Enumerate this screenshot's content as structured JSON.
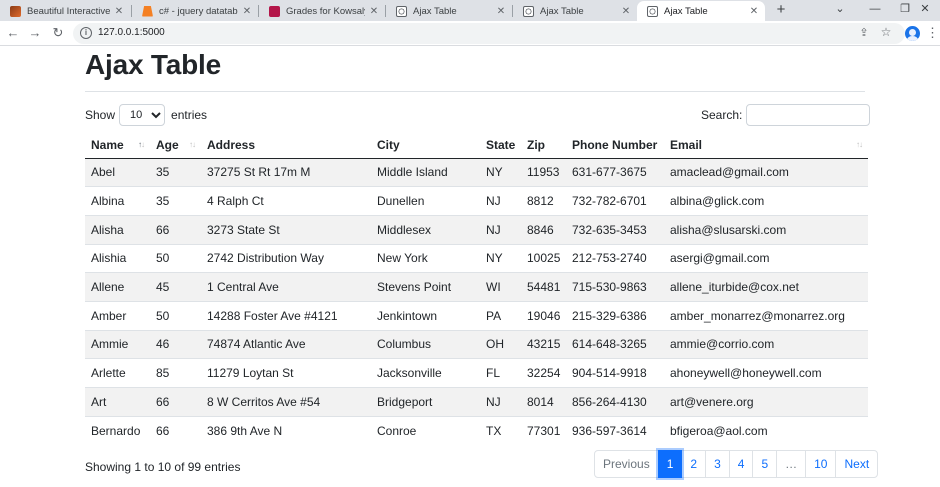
{
  "browser": {
    "tabs": [
      {
        "title": "Beautiful Interactive Ta",
        "favicon": "image-favicon"
      },
      {
        "title": "c# - jquery datatables",
        "favicon": "stackoverflow-favicon"
      },
      {
        "title": "Grades for Kowsalya V",
        "favicon": "grades-favicon"
      },
      {
        "title": "Ajax Table",
        "favicon": "globe-favicon"
      },
      {
        "title": "Ajax Table",
        "favicon": "globe-favicon"
      },
      {
        "title": "Ajax Table",
        "favicon": "globe-favicon",
        "active": true
      }
    ],
    "url": "127.0.0.1:5000"
  },
  "page": {
    "title": "Ajax Table",
    "length_prefix": "Show",
    "length_value": "10",
    "length_suffix": "entries",
    "search_label": "Search:",
    "search_value": ""
  },
  "table": {
    "columns": [
      "Name",
      "Age",
      "Address",
      "City",
      "State",
      "Zip",
      "Phone Number",
      "Email"
    ],
    "rows": [
      [
        "Abel",
        "35",
        "37275 St Rt 17m M",
        "Middle Island",
        "NY",
        "11953",
        "631-677-3675",
        "amaclead@gmail.com"
      ],
      [
        "Albina",
        "35",
        "4 Ralph Ct",
        "Dunellen",
        "NJ",
        "8812",
        "732-782-6701",
        "albina@glick.com"
      ],
      [
        "Alisha",
        "66",
        "3273 State St",
        "Middlesex",
        "NJ",
        "8846",
        "732-635-3453",
        "alisha@slusarski.com"
      ],
      [
        "Alishia",
        "50",
        "2742 Distribution Way",
        "New York",
        "NY",
        "10025",
        "212-753-2740",
        "asergi@gmail.com"
      ],
      [
        "Allene",
        "45",
        "1 Central Ave",
        "Stevens Point",
        "WI",
        "54481",
        "715-530-9863",
        "allene_iturbide@cox.net"
      ],
      [
        "Amber",
        "50",
        "14288 Foster Ave #4121",
        "Jenkintown",
        "PA",
        "19046",
        "215-329-6386",
        "amber_monarrez@monarrez.org"
      ],
      [
        "Ammie",
        "46",
        "74874 Atlantic Ave",
        "Columbus",
        "OH",
        "43215",
        "614-648-3265",
        "ammie@corrio.com"
      ],
      [
        "Arlette",
        "85",
        "11279 Loytan St",
        "Jacksonville",
        "FL",
        "32254",
        "904-514-9918",
        "ahoneywell@honeywell.com"
      ],
      [
        "Art",
        "66",
        "8 W Cerritos Ave #54",
        "Bridgeport",
        "NJ",
        "8014",
        "856-264-4130",
        "art@venere.org"
      ],
      [
        "Bernardo",
        "66",
        "386 9th Ave N",
        "Conroe",
        "TX",
        "77301",
        "936-597-3614",
        "bfigeroa@aol.com"
      ]
    ]
  },
  "footer": {
    "info": "Showing 1 to 10 of 99 entries",
    "pagination": [
      "Previous",
      "1",
      "2",
      "3",
      "4",
      "5",
      "…",
      "10",
      "Next"
    ],
    "active_page": "1"
  },
  "colors": {
    "accent": "#0d6efd",
    "stripe": "#f2f2f2"
  }
}
